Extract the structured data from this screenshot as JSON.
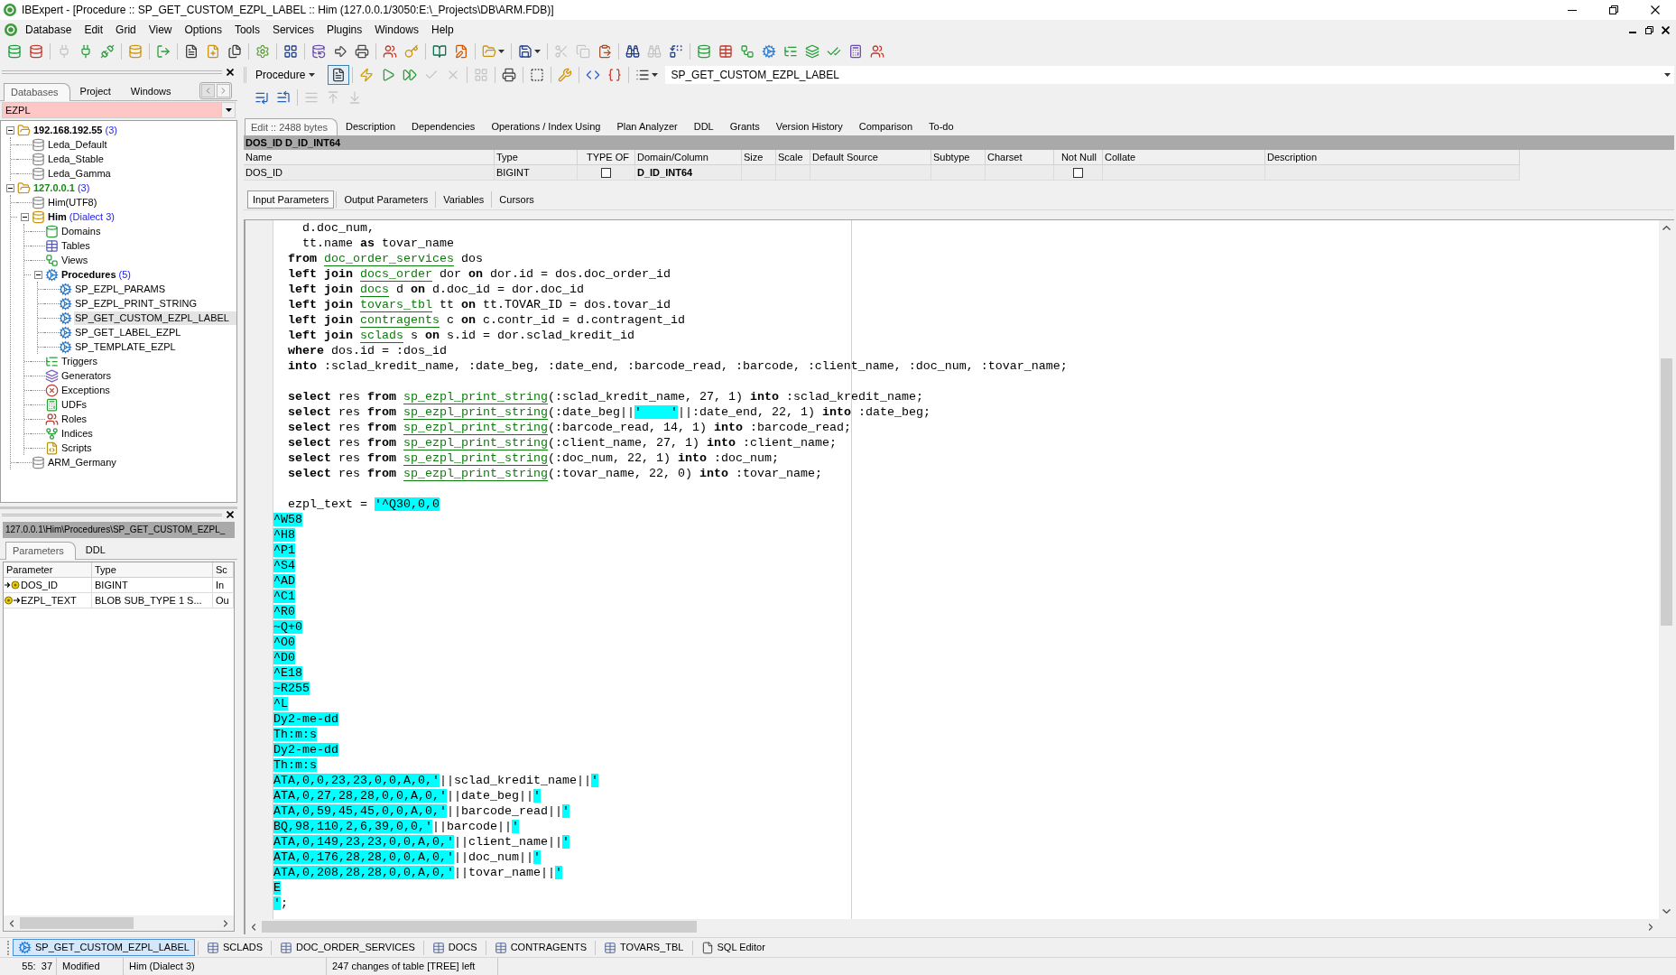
{
  "window": {
    "title": "IBExpert - [Procedure :: SP_GET_CUSTOM_EZPL_LABEL :: Him (127.0.0.1/3050:E:\\_Projects\\DB\\ARM.FDB)]"
  },
  "menu": [
    "Database",
    "Edit",
    "Grid",
    "View",
    "Options",
    "Tools",
    "Services",
    "Plugins",
    "Windows",
    "Help"
  ],
  "toolbar": {
    "groups": [
      {
        "buttons": [
          {
            "kind": "register",
            "disabled": false
          },
          {
            "kind": "unregister",
            "disabled": false
          }
        ]
      },
      {
        "buttons": [
          {
            "kind": "connect",
            "disabled": true
          },
          {
            "kind": "reconnect",
            "disabled": false
          },
          {
            "kind": "disconnect",
            "disabled": false
          }
        ]
      },
      {
        "buttons": [
          {
            "kind": "dbinfo",
            "disabled": false
          }
        ]
      },
      {
        "buttons": [
          {
            "kind": "exit",
            "disabled": false
          }
        ]
      },
      {
        "buttons": [
          {
            "kind": "page",
            "disabled": false
          },
          {
            "kind": "newpage",
            "disabled": false
          },
          {
            "kind": "pages",
            "disabled": false
          }
        ]
      },
      {
        "buttons": [
          {
            "kind": "settings",
            "disabled": false
          }
        ]
      },
      {
        "buttons": [
          {
            "kind": "grid",
            "disabled": false
          }
        ]
      },
      {
        "buttons": [
          {
            "kind": "export",
            "disabled": false
          },
          {
            "kind": "forward",
            "disabled": false
          },
          {
            "kind": "print",
            "disabled": false
          }
        ]
      },
      {
        "buttons": [
          {
            "kind": "users",
            "disabled": false
          },
          {
            "kind": "key",
            "disabled": false
          }
        ]
      },
      {
        "buttons": [
          {
            "kind": "book",
            "disabled": false
          },
          {
            "kind": "edit",
            "disabled": false
          }
        ]
      },
      {
        "buttons": [
          {
            "kind": "open",
            "disabled": false
          }
        ]
      },
      {
        "buttons": [
          {
            "kind": "save",
            "disabled": false
          }
        ]
      },
      {
        "buttons": [
          {
            "kind": "cut",
            "disabled": true
          },
          {
            "kind": "copy",
            "disabled": true
          },
          {
            "kind": "paste",
            "disabled": false
          }
        ]
      },
      {
        "buttons": [
          {
            "kind": "find",
            "disabled": false
          },
          {
            "kind": "findnext",
            "disabled": true
          },
          {
            "kind": "replace",
            "disabled": false
          }
        ]
      },
      {
        "buttons": [
          {
            "kind": "database",
            "disabled": false
          },
          {
            "kind": "table",
            "disabled": false
          },
          {
            "kind": "view",
            "disabled": false
          },
          {
            "kind": "procedure",
            "disabled": false
          },
          {
            "kind": "trigger",
            "disabled": false
          },
          {
            "kind": "generator",
            "disabled": false
          },
          {
            "kind": "exception",
            "disabled": false
          },
          {
            "kind": "udf",
            "disabled": false
          },
          {
            "kind": "role",
            "disabled": false
          }
        ]
      }
    ]
  },
  "left_panel": {
    "tabs": [
      {
        "label": "Databases",
        "selected": true
      },
      {
        "label": "Project",
        "selected": false
      },
      {
        "label": "Windows",
        "selected": false
      }
    ],
    "filter": {
      "value": "EZPL"
    },
    "tree": [
      {
        "kind": "server",
        "label": "192.168.192.55",
        "note": "(3)",
        "connected": false,
        "expanded": true,
        "selected": false,
        "children": [
          {
            "kind": "database",
            "label": "Leda_Default",
            "connected": false,
            "selected": false
          },
          {
            "kind": "database",
            "label": "Leda_Stable",
            "connected": false,
            "selected": false
          },
          {
            "kind": "database",
            "label": "Leda_Gamma",
            "connected": false,
            "selected": false
          }
        ]
      },
      {
        "kind": "server",
        "label": "127.0.0.1",
        "note": "(3)",
        "connected": true,
        "expanded": true,
        "selected": false,
        "children": [
          {
            "kind": "database",
            "label": "Him(UTF8)",
            "connected": false,
            "selected": false
          },
          {
            "kind": "database",
            "label": "Him",
            "note": "(Dialect 3)",
            "connected": true,
            "expanded": true,
            "selected": false,
            "children": [
              {
                "kind": "domains",
                "label": "Domains",
                "selected": false
              },
              {
                "kind": "tables",
                "label": "Tables",
                "selected": false
              },
              {
                "kind": "views",
                "label": "Views",
                "selected": false
              },
              {
                "kind": "procedures",
                "label": "Procedures",
                "note": "(5)",
                "expanded": true,
                "selected": false,
                "children": [
                  {
                    "kind": "procedure",
                    "label": "SP_EZPL_PARAMS",
                    "selected": false
                  },
                  {
                    "kind": "procedure",
                    "label": "SP_EZPL_PRINT_STRING",
                    "selected": false
                  },
                  {
                    "kind": "procedure",
                    "label": "SP_GET_CUSTOM_EZPL_LABEL",
                    "selected": true
                  },
                  {
                    "kind": "procedure",
                    "label": "SP_GET_LABEL_EZPL",
                    "selected": false
                  },
                  {
                    "kind": "procedure",
                    "label": "SP_TEMPLATE_EZPL",
                    "selected": false
                  }
                ]
              },
              {
                "kind": "triggers",
                "label": "Triggers",
                "selected": false
              },
              {
                "kind": "generators",
                "label": "Generators",
                "selected": false
              },
              {
                "kind": "exceptions",
                "label": "Exceptions",
                "selected": false
              },
              {
                "kind": "udfs",
                "label": "UDFs",
                "selected": false
              },
              {
                "kind": "roles",
                "label": "Roles",
                "selected": false
              },
              {
                "kind": "indices",
                "label": "Indices",
                "selected": false
              },
              {
                "kind": "scripts",
                "label": "Scripts",
                "selected": false
              }
            ]
          },
          {
            "kind": "database",
            "label": "ARM_Germany",
            "connected": false,
            "selected": false
          }
        ]
      }
    ]
  },
  "parameters_panel": {
    "path": "127.0.0.1\\Him\\Procedures\\SP_GET_CUSTOM_EZPL_",
    "tabs": [
      {
        "label": "Parameters",
        "selected": true
      },
      {
        "label": "DDL",
        "selected": false
      }
    ],
    "columns": [
      "Parameter",
      "Type",
      "Sc"
    ],
    "rows": [
      {
        "kind": "input",
        "cells": [
          "DOS_ID",
          "BIGINT",
          "In"
        ]
      },
      {
        "kind": "output",
        "cells": [
          "EZPL_TEXT",
          "BLOB SUB_TYPE 1 S...",
          "Ou"
        ]
      }
    ]
  },
  "editor": {
    "object_type": "Procedure",
    "toolbar": {
      "groups": [
        {
          "buttons": [
            {
              "kind": "page",
              "disabled": false,
              "pressed": true
            }
          ]
        },
        {
          "buttons": [
            {
              "kind": "compile",
              "disabled": false,
              "pressed": false
            },
            {
              "kind": "run",
              "disabled": false,
              "pressed": false
            },
            {
              "kind": "step",
              "disabled": false,
              "pressed": false
            },
            {
              "kind": "commit",
              "disabled": true,
              "pressed": false
            },
            {
              "kind": "rollback",
              "disabled": true,
              "pressed": false
            }
          ]
        },
        {
          "buttons": [
            {
              "kind": "grid",
              "disabled": true,
              "pressed": false
            }
          ]
        },
        {
          "buttons": [
            {
              "kind": "print",
              "disabled": false,
              "pressed": false
            }
          ]
        },
        {
          "buttons": [
            {
              "kind": "select",
              "disabled": false,
              "pressed": false
            }
          ]
        },
        {
          "buttons": [
            {
              "kind": "tools",
              "disabled": false,
              "pressed": false
            }
          ]
        },
        {
          "buttons": [
            {
              "kind": "lower",
              "disabled": false,
              "pressed": false
            },
            {
              "kind": "upper",
              "disabled": false,
              "pressed": false
            }
          ]
        },
        {
          "buttons": [
            {
              "kind": "list",
              "disabled": false,
              "pressed": false
            }
          ]
        }
      ]
    },
    "object_name": "SP_GET_CUSTOM_EZPL_LABEL",
    "format_toolbar": {
      "groups": [
        {
          "buttons": [
            {
              "kind": "indent",
              "disabled": false
            },
            {
              "kind": "unindent",
              "disabled": false
            }
          ]
        },
        {
          "buttons": [
            {
              "kind": "block",
              "disabled": true
            },
            {
              "kind": "moveup",
              "disabled": true
            },
            {
              "kind": "movedown",
              "disabled": true
            }
          ]
        }
      ]
    },
    "tabs": [
      {
        "label": "Edit :: 2488 bytes",
        "selected": true
      },
      {
        "label": "Description",
        "selected": false
      },
      {
        "label": "Dependencies",
        "selected": false
      },
      {
        "label": "Operations / Index Using",
        "selected": false
      },
      {
        "label": "Plan Analyzer",
        "selected": false
      },
      {
        "label": "DDL",
        "selected": false
      },
      {
        "label": "Grants",
        "selected": false
      },
      {
        "label": "Version History",
        "selected": false
      },
      {
        "label": "Comparison",
        "selected": false
      },
      {
        "label": "To-do",
        "selected": false
      }
    ],
    "field_caption": "DOS_ID D_ID_INT64",
    "fields": {
      "columns": [
        "Name",
        "Type",
        "TYPE OF",
        "Domain/Column",
        "Size",
        "Scale",
        "Default Source",
        "Subtype",
        "Charset",
        "Not Null",
        "Collate",
        "Description"
      ],
      "rows": [
        {
          "cells": [
            {
              "kind": "text",
              "text": "DOS_ID"
            },
            {
              "kind": "text",
              "text": "BIGINT"
            },
            {
              "kind": "checkbox",
              "checked": false
            },
            {
              "kind": "domain",
              "text": "D_ID_INT64"
            },
            null,
            null,
            null,
            null,
            null,
            {
              "kind": "checkbox",
              "checked": false
            },
            null,
            null
          ]
        }
      ]
    },
    "section_tabs": [
      {
        "label": "Input Parameters",
        "selected": true
      },
      {
        "label": "Output Parameters",
        "selected": false
      },
      {
        "label": "Variables",
        "selected": false
      },
      {
        "label": "Cursors",
        "selected": false
      }
    ],
    "code": [
      {
        "lines": [
          [
            {
              "kind": "plain",
              "text": "    d.doc_num,"
            }
          ],
          [
            {
              "kind": "plain",
              "text": "    tt.name "
            },
            {
              "kind": "keyword",
              "text": "as"
            },
            {
              "kind": "plain",
              "text": " tovar_name"
            }
          ],
          [
            {
              "kind": "keyword",
              "text": "  from "
            },
            {
              "kind": "link",
              "text": "doc_order_services"
            },
            {
              "kind": "plain",
              "text": " dos"
            }
          ],
          [
            {
              "kind": "keyword",
              "text": "  left join "
            },
            {
              "kind": "link",
              "text": "docs_order"
            },
            {
              "kind": "plain",
              "text": " dor "
            },
            {
              "kind": "keyword",
              "text": "on"
            },
            {
              "kind": "plain",
              "text": " dor.id = dos.doc_order_id"
            }
          ],
          [
            {
              "kind": "keyword",
              "text": "  left join "
            },
            {
              "kind": "link",
              "text": "docs"
            },
            {
              "kind": "plain",
              "text": " d "
            },
            {
              "kind": "keyword",
              "text": "on"
            },
            {
              "kind": "plain",
              "text": " d.doc_id = dor.doc_id"
            }
          ],
          [
            {
              "kind": "keyword",
              "text": "  left join "
            },
            {
              "kind": "link",
              "text": "tovars_tbl"
            },
            {
              "kind": "plain",
              "text": " tt "
            },
            {
              "kind": "keyword",
              "text": "on"
            },
            {
              "kind": "plain",
              "text": " tt.TOVAR_ID = dos.tovar_id"
            }
          ],
          [
            {
              "kind": "keyword",
              "text": "  left join "
            },
            {
              "kind": "link",
              "text": "contragents"
            },
            {
              "kind": "plain",
              "text": " c "
            },
            {
              "kind": "keyword",
              "text": "on"
            },
            {
              "kind": "plain",
              "text": " c.contr_id = d.contragent_id"
            }
          ],
          [
            {
              "kind": "keyword",
              "text": "  left join "
            },
            {
              "kind": "link",
              "text": "sclads"
            },
            {
              "kind": "plain",
              "text": " s "
            },
            {
              "kind": "keyword",
              "text": "on"
            },
            {
              "kind": "plain",
              "text": " s.id = dor.sclad_kredit_id"
            }
          ],
          [
            {
              "kind": "keyword",
              "text": "  where"
            },
            {
              "kind": "plain",
              "text": " dos.id = :dos_id"
            }
          ],
          [
            {
              "kind": "keyword",
              "text": "  into"
            },
            {
              "kind": "plain",
              "text": " :sclad_kredit_name, :date_beg, :date_end, :barcode_read, :barcode, :client_name, :doc_num, :tovar_name;"
            }
          ]
        ]
      },
      {
        "lines": [
          [
            {
              "kind": "keyword",
              "text": "  select "
            },
            {
              "kind": "plain",
              "text": "res "
            },
            {
              "kind": "keyword",
              "text": "from "
            },
            {
              "kind": "link",
              "text": "sp_ezpl_print_string"
            },
            {
              "kind": "plain",
              "text": "(:sclad_kredit_name, 27, 1) "
            },
            {
              "kind": "keyword",
              "text": "into"
            },
            {
              "kind": "plain",
              "text": " :sclad_kredit_name;"
            }
          ],
          [
            {
              "kind": "keyword",
              "text": "  select "
            },
            {
              "kind": "plain",
              "text": "res "
            },
            {
              "kind": "keyword",
              "text": "from "
            },
            {
              "kind": "link",
              "text": "sp_ezpl_print_string"
            },
            {
              "kind": "plain",
              "text": "(:date_beg||"
            },
            {
              "kind": "highlight",
              "text": "'    '"
            },
            {
              "kind": "plain",
              "text": "||:date_end, 22, 1) "
            },
            {
              "kind": "keyword",
              "text": "into"
            },
            {
              "kind": "plain",
              "text": " :date_beg;"
            }
          ],
          [
            {
              "kind": "keyword",
              "text": "  select "
            },
            {
              "kind": "plain",
              "text": "res "
            },
            {
              "kind": "keyword",
              "text": "from "
            },
            {
              "kind": "link",
              "text": "sp_ezpl_print_string"
            },
            {
              "kind": "plain",
              "text": "(:barcode_read, 14, 1) "
            },
            {
              "kind": "keyword",
              "text": "into"
            },
            {
              "kind": "plain",
              "text": " :barcode_read;"
            }
          ],
          [
            {
              "kind": "keyword",
              "text": "  select "
            },
            {
              "kind": "plain",
              "text": "res "
            },
            {
              "kind": "keyword",
              "text": "from "
            },
            {
              "kind": "link",
              "text": "sp_ezpl_print_string"
            },
            {
              "kind": "plain",
              "text": "(:client_name, 27, 1) "
            },
            {
              "kind": "keyword",
              "text": "into"
            },
            {
              "kind": "plain",
              "text": " :client_name;"
            }
          ],
          [
            {
              "kind": "keyword",
              "text": "  select "
            },
            {
              "kind": "plain",
              "text": "res "
            },
            {
              "kind": "keyword",
              "text": "from "
            },
            {
              "kind": "link",
              "text": "sp_ezpl_print_string"
            },
            {
              "kind": "plain",
              "text": "(:doc_num, 22, 1) "
            },
            {
              "kind": "keyword",
              "text": "into"
            },
            {
              "kind": "plain",
              "text": " :doc_num;"
            }
          ],
          [
            {
              "kind": "keyword",
              "text": "  select "
            },
            {
              "kind": "plain",
              "text": "res "
            },
            {
              "kind": "keyword",
              "text": "from "
            },
            {
              "kind": "link",
              "text": "sp_ezpl_print_string"
            },
            {
              "kind": "plain",
              "text": "(:tovar_name, 22, 0) "
            },
            {
              "kind": "keyword",
              "text": "into"
            },
            {
              "kind": "plain",
              "text": " :tovar_name;"
            }
          ]
        ]
      },
      {
        "lines": [
          [
            {
              "kind": "plain",
              "text": "  ezpl_text = "
            },
            {
              "kind": "highlight",
              "text": "'^Q30,0,0"
            }
          ],
          [
            {
              "kind": "highlight",
              "text": "^W58"
            }
          ],
          [
            {
              "kind": "highlight",
              "text": "^H8"
            }
          ],
          [
            {
              "kind": "highlight",
              "text": "^P1"
            }
          ],
          [
            {
              "kind": "highlight",
              "text": "^S4"
            }
          ],
          [
            {
              "kind": "highlight",
              "text": "^AD"
            }
          ],
          [
            {
              "kind": "highlight",
              "text": "^C1"
            }
          ],
          [
            {
              "kind": "highlight",
              "text": "^R0"
            }
          ],
          [
            {
              "kind": "highlight",
              "text": "~Q+0"
            }
          ],
          [
            {
              "kind": "highlight",
              "text": "^O0"
            }
          ],
          [
            {
              "kind": "highlight",
              "text": "^D0"
            }
          ],
          [
            {
              "kind": "highlight",
              "text": "^E18"
            }
          ],
          [
            {
              "kind": "highlight",
              "text": "~R255"
            }
          ],
          [
            {
              "kind": "highlight",
              "text": "^L"
            }
          ],
          [
            {
              "kind": "highlight",
              "text": "Dy2-me-dd"
            }
          ],
          [
            {
              "kind": "highlight",
              "text": "Th:m:s"
            }
          ],
          [
            {
              "kind": "highlight",
              "text": "Dy2-me-dd"
            }
          ],
          [
            {
              "kind": "highlight",
              "text": "Th:m:s"
            }
          ],
          [
            {
              "kind": "highlight",
              "text": "ATA,0,0,23,23,0,0,A,0,'"
            },
            {
              "kind": "plain",
              "text": "||sclad_kredit_name||"
            },
            {
              "kind": "highlight",
              "text": "'"
            }
          ],
          [
            {
              "kind": "highlight",
              "text": "ATA,0,27,28,28,0,0,A,0,'"
            },
            {
              "kind": "plain",
              "text": "||date_beg||"
            },
            {
              "kind": "highlight",
              "text": "'"
            }
          ],
          [
            {
              "kind": "highlight",
              "text": "ATA,0,59,45,45,0,0,A,0,'"
            },
            {
              "kind": "plain",
              "text": "||barcode_read||"
            },
            {
              "kind": "highlight",
              "text": "'"
            }
          ],
          [
            {
              "kind": "highlight",
              "text": "BQ,98,110,2,6,39,0,0,'"
            },
            {
              "kind": "plain",
              "text": "||barcode||"
            },
            {
              "kind": "highlight",
              "text": "'"
            }
          ],
          [
            {
              "kind": "highlight",
              "text": "ATA,0,149,23,23,0,0,A,0,'"
            },
            {
              "kind": "plain",
              "text": "||client_name||"
            },
            {
              "kind": "highlight",
              "text": "'"
            }
          ],
          [
            {
              "kind": "highlight",
              "text": "ATA,0,176,28,28,0,0,A,0,'"
            },
            {
              "kind": "plain",
              "text": "||doc_num||"
            },
            {
              "kind": "highlight",
              "text": "'"
            }
          ],
          [
            {
              "kind": "highlight",
              "text": "ATA,0,208,28,28,0,0,A,0,'"
            },
            {
              "kind": "plain",
              "text": "||tovar_name||"
            },
            {
              "kind": "highlight",
              "text": "'"
            }
          ],
          [
            {
              "kind": "highlight",
              "text": "E"
            }
          ],
          [
            {
              "kind": "highlight",
              "text": "'"
            },
            {
              "kind": "plain",
              "text": ";"
            }
          ]
        ]
      }
    ]
  },
  "window_tabs": [
    {
      "kind": "procedure",
      "label": "SP_GET_CUSTOM_EZPL_LABEL",
      "selected": true
    },
    {
      "kind": "table",
      "label": "SCLADS",
      "selected": false
    },
    {
      "kind": "table",
      "label": "DOC_ORDER_SERVICES",
      "selected": false
    },
    {
      "kind": "table",
      "label": "DOCS",
      "selected": false
    },
    {
      "kind": "table",
      "label": "CONTRAGENTS",
      "selected": false
    },
    {
      "kind": "table",
      "label": "TOVARS_TBL",
      "selected": false
    },
    {
      "kind": "sql",
      "label": "SQL Editor",
      "selected": false
    }
  ],
  "status_bar": {
    "cells": [
      "55:  37",
      "Modified",
      "Him (Dialect 3)",
      "247 changes of table [TREE] left"
    ]
  }
}
